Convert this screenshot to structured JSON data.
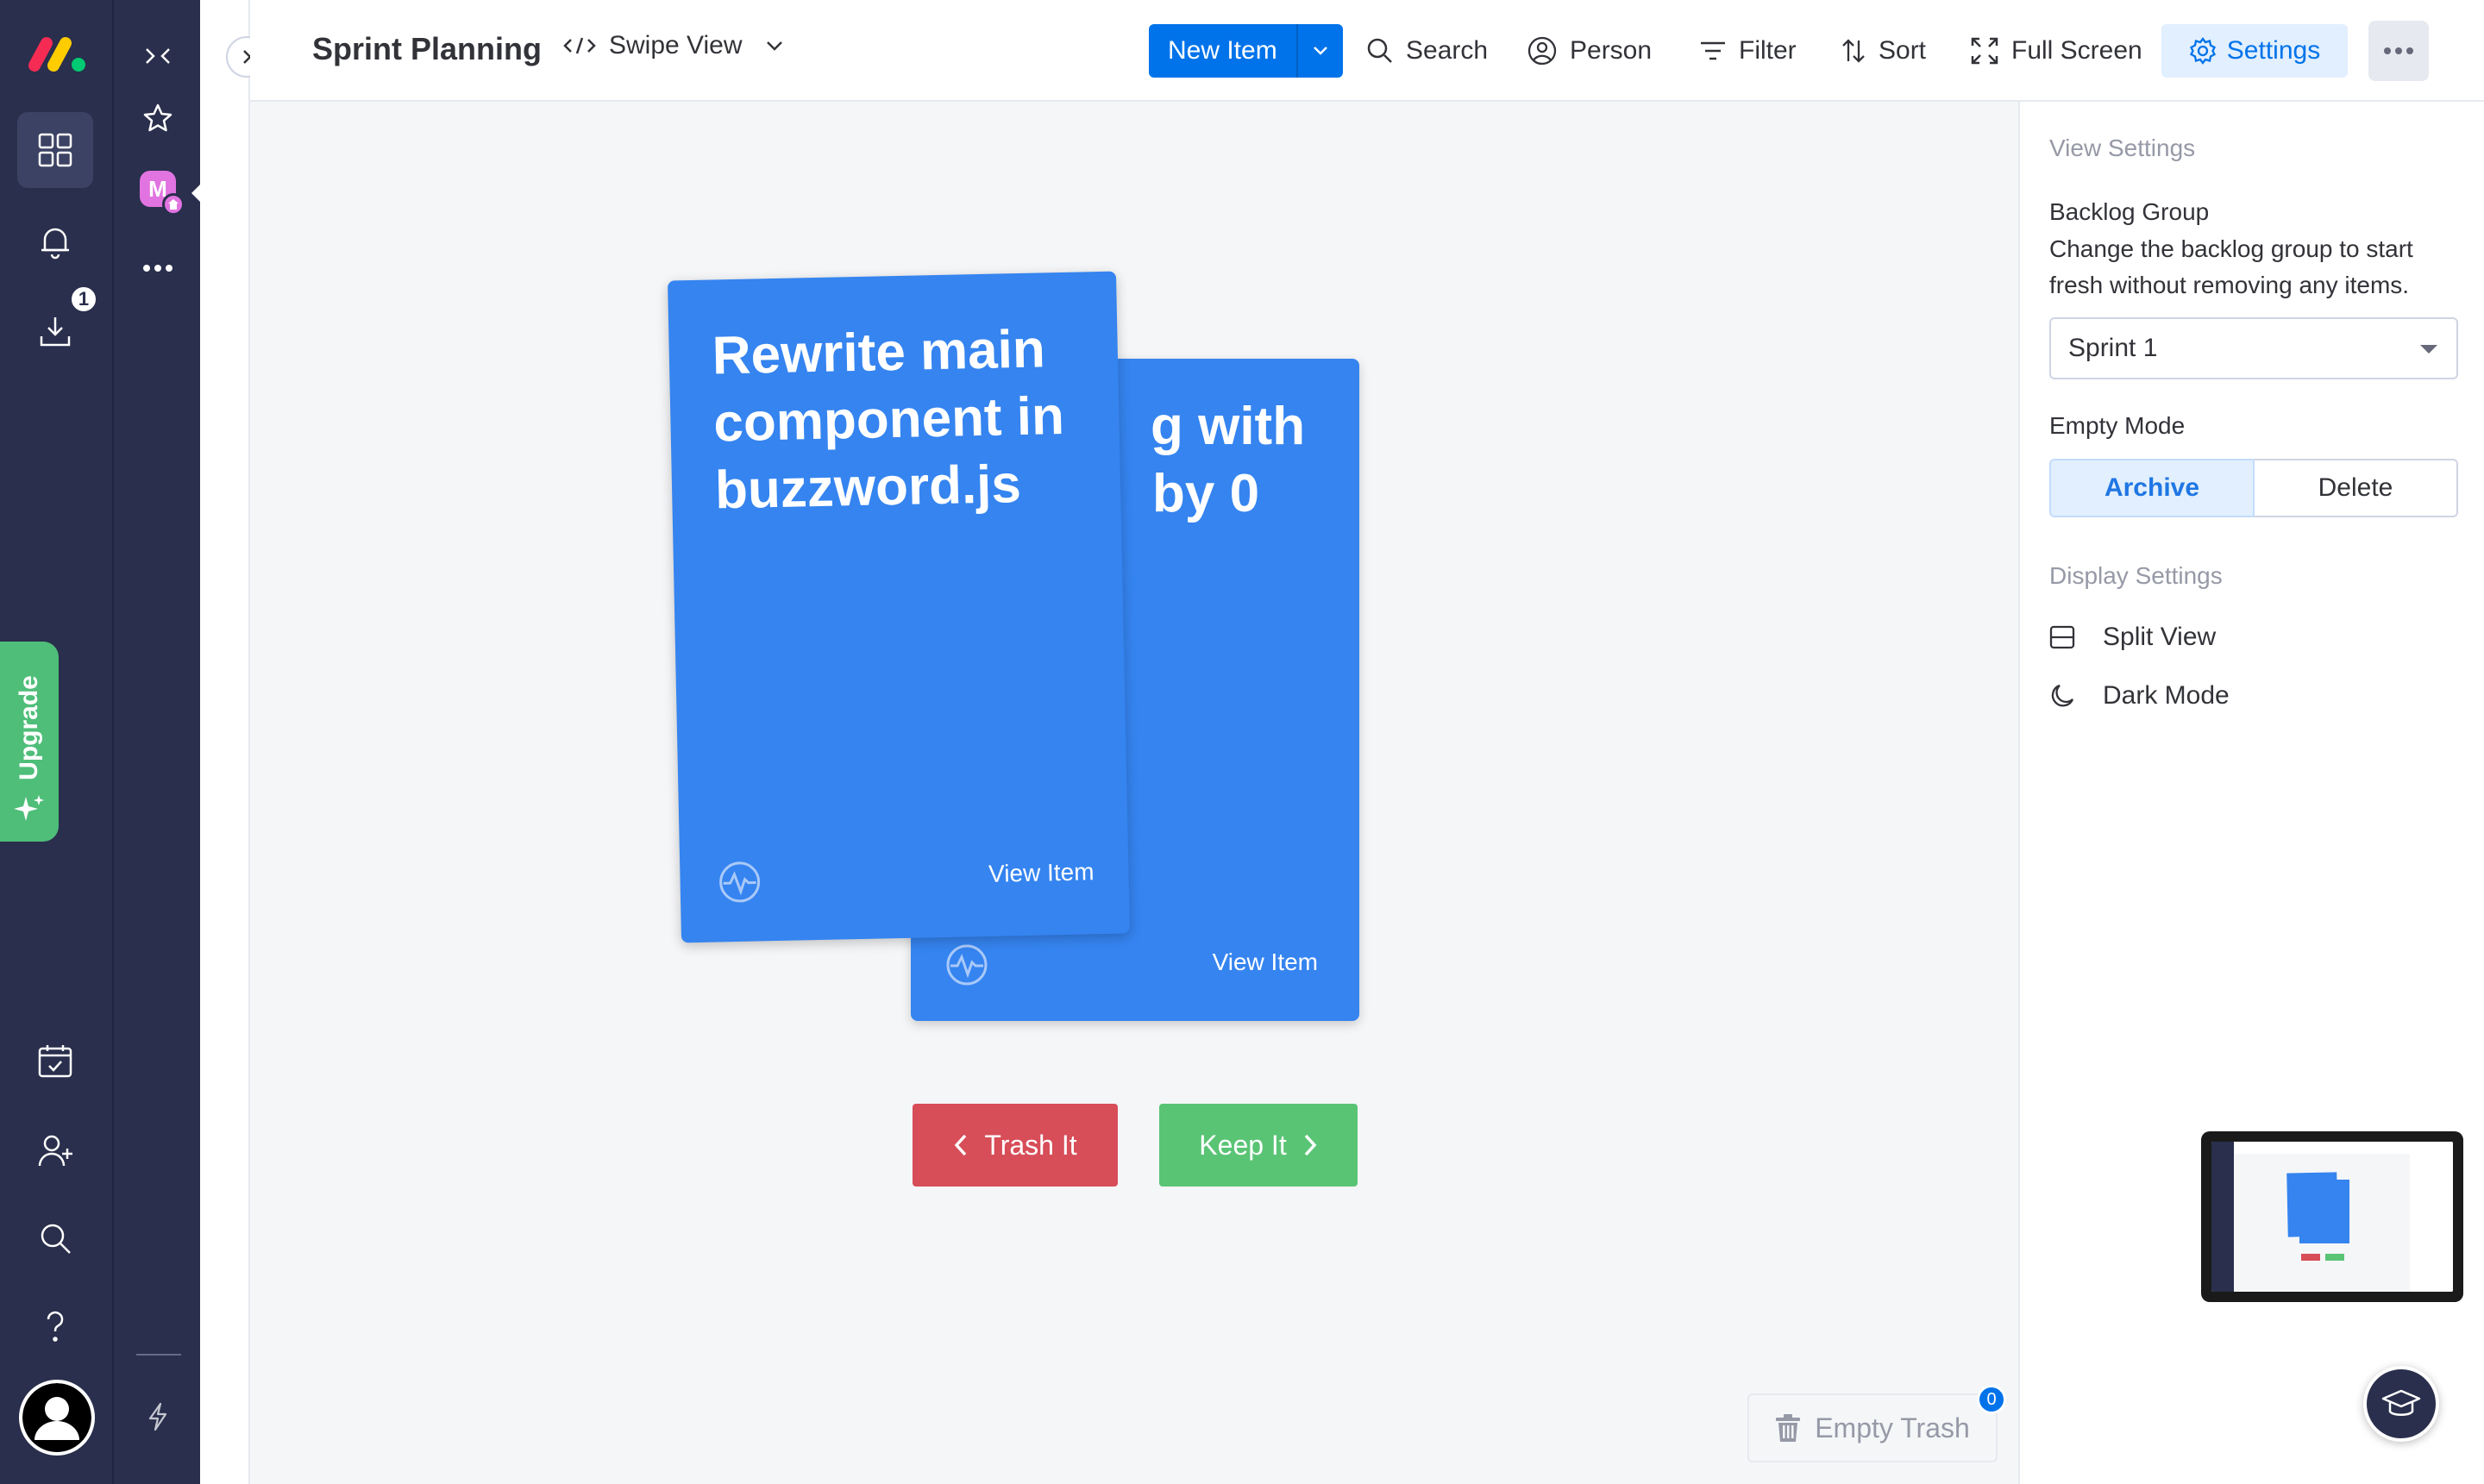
{
  "app": {
    "brand_colors": [
      "#f62b54",
      "#ffcc00",
      "#00ca72"
    ],
    "rail_badge_count": "1",
    "upgrade_label": "Upgrade"
  },
  "workspace": {
    "initial": "M"
  },
  "header": {
    "title": "Sprint Planning",
    "view_name": "Swipe View",
    "new_item_label": "New Item",
    "search_label": "Search",
    "person_label": "Person",
    "filter_label": "Filter",
    "sort_label": "Sort",
    "fullscreen_label": "Full Screen",
    "settings_label": "Settings"
  },
  "cards": {
    "front": {
      "title": "Rewrite main component in buzzword.js",
      "action": "View Item"
    },
    "back": {
      "visible_title": "g with by 0",
      "line1": "g with",
      "line2": "by 0",
      "action": "View Item"
    }
  },
  "actions": {
    "trash_label": "Trash It",
    "keep_label": "Keep It",
    "empty_trash_label": "Empty Trash",
    "trash_count": "0"
  },
  "settings": {
    "section_title": "View Settings",
    "backlog_group_label": "Backlog Group",
    "backlog_group_desc": "Change the backlog group to start fresh without removing any items.",
    "backlog_group_value": "Sprint 1",
    "empty_mode_label": "Empty Mode",
    "empty_mode_options": [
      "Archive",
      "Delete"
    ],
    "empty_mode_selected": "Archive",
    "display_title": "Display Settings",
    "split_view_label": "Split View",
    "dark_mode_label": "Dark Mode"
  },
  "colors": {
    "primary": "#0073ea",
    "card": "#3584f0",
    "trash": "#d74d58",
    "keep": "#5ac475",
    "rail": "#292f4c"
  }
}
